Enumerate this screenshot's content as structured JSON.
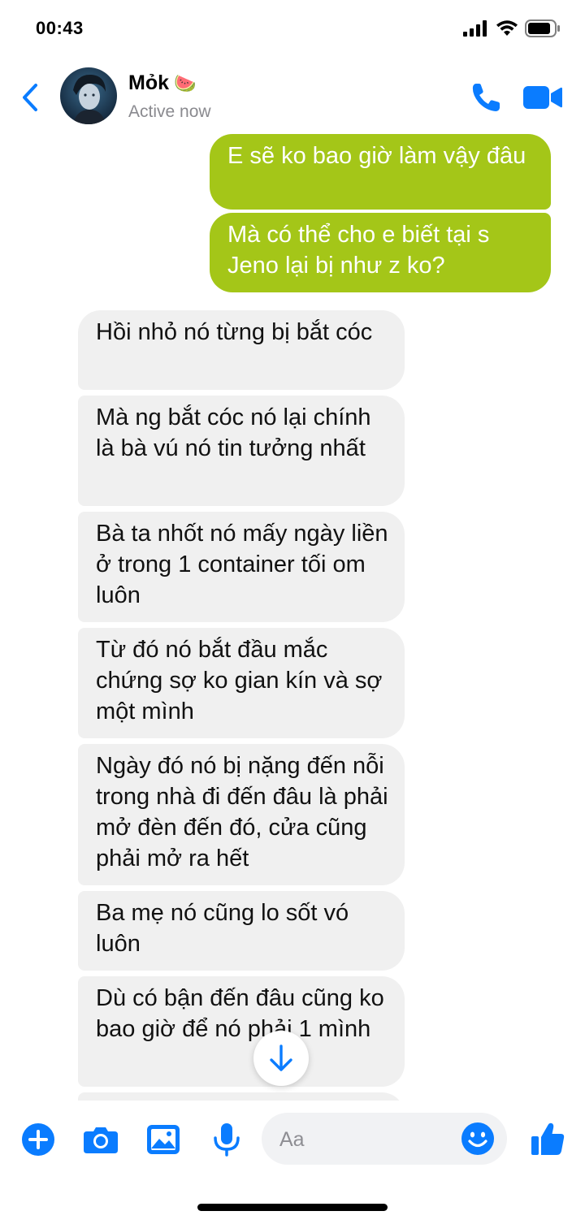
{
  "status_bar": {
    "time": "00:43"
  },
  "header": {
    "contact_name": "Mỏk",
    "name_emoji": "🍉",
    "contact_status": "Active now"
  },
  "colors": {
    "accent": "#0a7cff",
    "outgoing_bubble": "#a4c618",
    "incoming_bubble": "#f0f0f0"
  },
  "messages": [
    {
      "direction": "outgoing",
      "text": "E sẽ ko bao giờ làm vậy đâu"
    },
    {
      "direction": "outgoing",
      "text": "Mà có thể cho e biết tại s Jeno lại bị như z ko?"
    },
    {
      "direction": "incoming",
      "text": "Hồi nhỏ nó từng bị bắt cóc"
    },
    {
      "direction": "incoming",
      "text": "Mà ng bắt cóc nó lại chính là bà vú nó tin tưởng nhất"
    },
    {
      "direction": "incoming",
      "text": "Bà ta nhốt nó mấy ngày liền ở trong 1 container tối om luôn"
    },
    {
      "direction": "incoming",
      "text": "Từ đó nó bắt đầu mắc chứng sợ ko gian kín và sợ một mình"
    },
    {
      "direction": "incoming",
      "text": "Ngày đó nó bị nặng đến nỗi trong nhà đi đến đâu là phải mở đèn đến đó, cửa cũng phải mở ra hết"
    },
    {
      "direction": "incoming",
      "text": "Ba mẹ nó cũng lo sốt vó luôn"
    },
    {
      "direction": "incoming",
      "text": "Dù có bận đến đâu cũng ko bao giờ để nó phải 1 mình"
    }
  ],
  "composer": {
    "placeholder": "Aa"
  },
  "icons": {
    "back": "chevron-left-icon",
    "call": "phone-icon",
    "video": "video-camera-icon",
    "add": "plus-circle-icon",
    "camera": "camera-icon",
    "gallery": "image-icon",
    "mic": "microphone-icon",
    "emoji": "smiley-icon",
    "like": "thumbs-up-icon",
    "scroll": "arrow-down-icon"
  }
}
